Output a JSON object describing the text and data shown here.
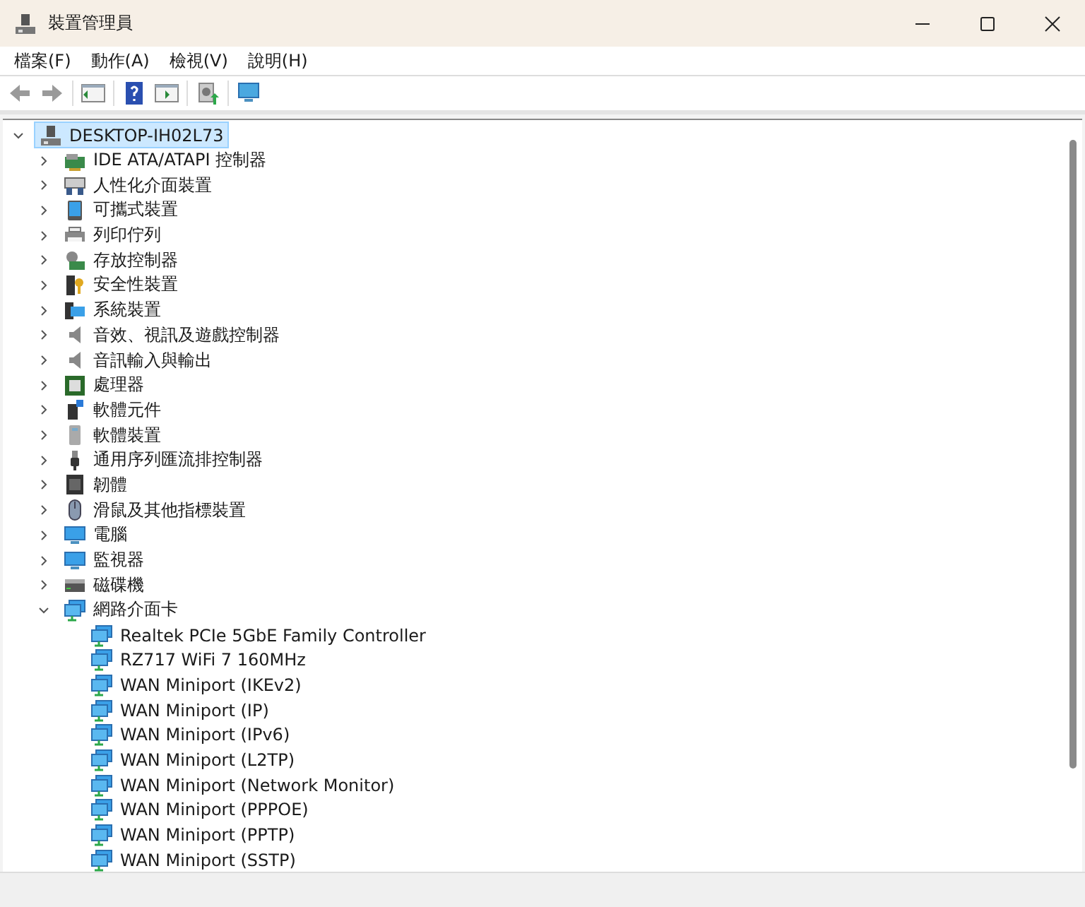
{
  "window": {
    "title": "裝置管理員"
  },
  "menu": [
    "檔案(F)",
    "動作(A)",
    "檢視(V)",
    "說明(H)"
  ],
  "tree": {
    "label": "DESKTOP-IH02L73",
    "expanded": true,
    "selected": true,
    "children": [
      {
        "label": "IDE ATA/ATAPI 控制器",
        "expanded": false,
        "selected": false
      },
      {
        "label": "人性化介面裝置",
        "expanded": false,
        "selected": false
      },
      {
        "label": "可攜式裝置",
        "expanded": false,
        "selected": false
      },
      {
        "label": "列印佇列",
        "expanded": false,
        "selected": false
      },
      {
        "label": "存放控制器",
        "expanded": false,
        "selected": false
      },
      {
        "label": "安全性裝置",
        "expanded": false,
        "selected": false
      },
      {
        "label": "系統裝置",
        "expanded": false,
        "selected": false
      },
      {
        "label": "音效、視訊及遊戲控制器",
        "expanded": false,
        "selected": false
      },
      {
        "label": "音訊輸入與輸出",
        "expanded": false,
        "selected": false
      },
      {
        "label": "處理器",
        "expanded": false,
        "selected": false
      },
      {
        "label": "軟體元件",
        "expanded": false,
        "selected": false
      },
      {
        "label": "軟體裝置",
        "expanded": false,
        "selected": false
      },
      {
        "label": "通用序列匯流排控制器",
        "expanded": false,
        "selected": false
      },
      {
        "label": "韌體",
        "expanded": false,
        "selected": false
      },
      {
        "label": "滑鼠及其他指標裝置",
        "expanded": false,
        "selected": false
      },
      {
        "label": "電腦",
        "expanded": false,
        "selected": false
      },
      {
        "label": "監視器",
        "expanded": false,
        "selected": false
      },
      {
        "label": "磁碟機",
        "expanded": false,
        "selected": false
      },
      {
        "label": "網路介面卡",
        "expanded": true,
        "selected": false,
        "children": [
          {
            "label": "Realtek PCIe 5GbE Family Controller",
            "selected": false
          },
          {
            "label": "RZ717 WiFi 7 160MHz",
            "selected": false
          },
          {
            "label": "WAN Miniport (IKEv2)",
            "selected": false
          },
          {
            "label": "WAN Miniport (IP)",
            "selected": false
          },
          {
            "label": "WAN Miniport (IPv6)",
            "selected": false
          },
          {
            "label": "WAN Miniport (L2TP)",
            "selected": false
          },
          {
            "label": "WAN Miniport (Network Monitor)",
            "selected": false
          },
          {
            "label": "WAN Miniport (PPPOE)",
            "selected": false
          },
          {
            "label": "WAN Miniport (PPTP)",
            "selected": false
          },
          {
            "label": "WAN Miniport (SSTP)",
            "selected": false
          }
        ]
      }
    ]
  }
}
